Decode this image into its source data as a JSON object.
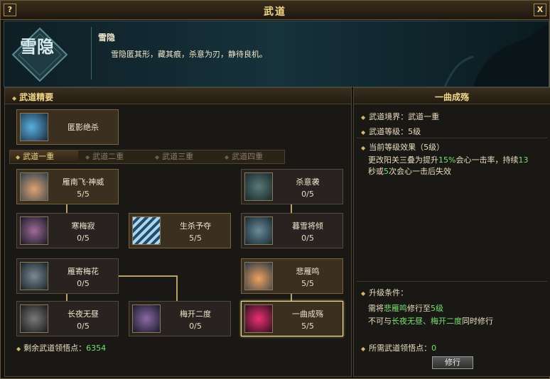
{
  "window": {
    "title": "武道",
    "help_label": "?",
    "close_label": "X"
  },
  "banner": {
    "emblem_text": "雪隐",
    "skill_name": "雪隐",
    "skill_desc": "雪隐匿其形，藏其痕，杀意为刃，静待良机。"
  },
  "left": {
    "section_title": "武道精要",
    "essence": {
      "name": "匿影绝杀"
    },
    "tabs": [
      "武道一重",
      "武道二重",
      "武道三重",
      "武道四重"
    ],
    "active_tab": 0,
    "nodes": [
      {
        "name": "雁南飞·神威",
        "level": "5/5"
      },
      {
        "name": "杀意袭",
        "level": "0/5"
      },
      {
        "name": "寒梅寂",
        "level": "0/5"
      },
      {
        "name": "生杀予夺",
        "level": "5/5"
      },
      {
        "name": "暮雪将倾",
        "level": "0/5"
      },
      {
        "name": "雁寄梅花",
        "level": "0/5"
      },
      {
        "name": "悲雁鸣",
        "level": "5/5"
      },
      {
        "name": "长夜无昼",
        "level": "0/5"
      },
      {
        "name": "梅开二度",
        "level": "0/5"
      },
      {
        "name": "一曲成殇",
        "level": "5/5"
      }
    ],
    "points_label": "剩余武道领悟点：",
    "points_value": "6354"
  },
  "right": {
    "title": "一曲成殇",
    "realm_label": "武道境界：",
    "realm_value": "武道一重",
    "level_label": "武道等级：",
    "level_value": "5级",
    "effect_header": "当前等级效果（5级）",
    "effect_line1_a": "更改阳关三叠为提升",
    "effect_line1_b": "15%",
    "effect_line1_c": "会心一击率，持续",
    "effect_line1_d": "13",
    "effect_line2_a": "秒或",
    "effect_line2_b": "5",
    "effect_line2_c": "次会心一击后失效",
    "upgrade_header": "升级条件：",
    "upgrade_line1_a": "需将",
    "upgrade_line1_b": "悲雁鸣",
    "upgrade_line1_c": "修行至",
    "upgrade_line1_d": "5级",
    "upgrade_line2_a": "不可与",
    "upgrade_line2_b": "长夜无昼、梅开二度",
    "upgrade_line2_c": "同时修行",
    "need_points_label": "所需武道领悟点：",
    "need_points_value": "0",
    "train_button": "修行"
  },
  "colors": {
    "accent": "#f2d98a",
    "green": "#78e070",
    "red": "#ff4040"
  }
}
